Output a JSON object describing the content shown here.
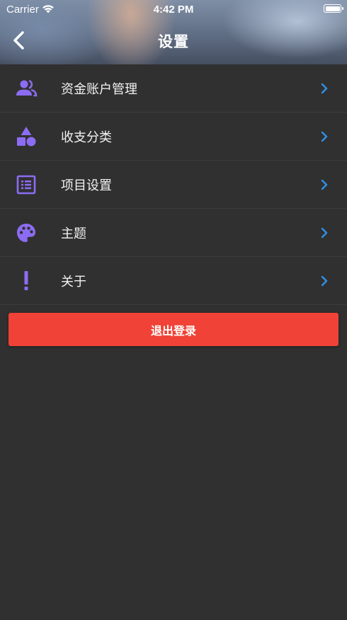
{
  "status_bar": {
    "carrier": "Carrier",
    "time": "4:42 PM"
  },
  "header": {
    "title": "设置",
    "back_icon": "chevron-left-icon"
  },
  "menu": {
    "items": [
      {
        "label": "资金账户管理",
        "icon": "people-icon"
      },
      {
        "label": "收支分类",
        "icon": "shapes-icon"
      },
      {
        "label": "项目设置",
        "icon": "list-icon"
      },
      {
        "label": "主题",
        "icon": "palette-icon"
      },
      {
        "label": "关于",
        "icon": "exclamation-icon"
      }
    ]
  },
  "logout": {
    "label": "退出登录"
  },
  "colors": {
    "background": "#303030",
    "icon_purple": "#8c6cf2",
    "chevron_blue": "#2f8fe3",
    "logout_red": "#f04236"
  }
}
